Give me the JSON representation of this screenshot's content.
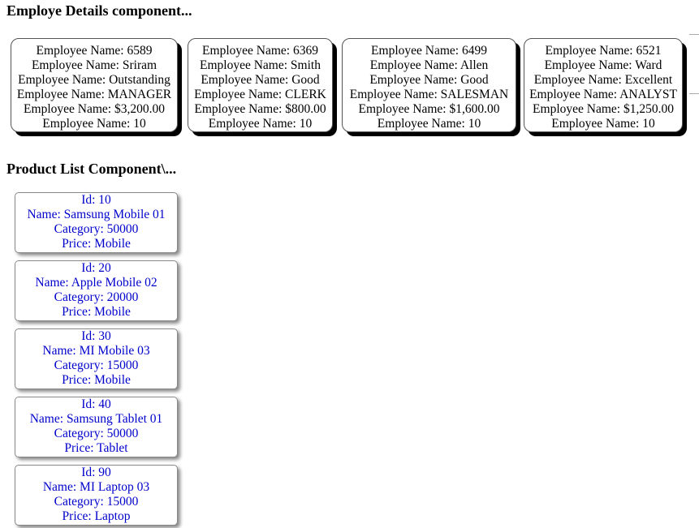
{
  "employee_section": {
    "heading": "Employe Details component...",
    "label": "Employee Name: ",
    "employees": [
      {
        "id": "6589",
        "name": "Sriram",
        "rating": "Outstanding",
        "job": "MANAGER",
        "salary": "$3,200.00",
        "dept": "10"
      },
      {
        "id": "6369",
        "name": "Smith",
        "rating": "Good",
        "job": "CLERK",
        "salary": "$800.00",
        "dept": "10"
      },
      {
        "id": "6499",
        "name": "Allen",
        "rating": "Good",
        "job": "SALESMAN",
        "salary": "$1,600.00",
        "dept": "10"
      },
      {
        "id": "6521",
        "name": "Ward",
        "rating": "Excellent",
        "job": "ANALYST",
        "salary": "$1,250.00",
        "dept": "10"
      }
    ]
  },
  "product_section": {
    "heading": "Product List Component\\...",
    "labels": {
      "id": "Id: ",
      "name": "Name: ",
      "category": "Category: ",
      "price": "Price: "
    },
    "products": [
      {
        "id": "10",
        "name": "Samsung Mobile 01",
        "category": "50000",
        "price": "Mobile"
      },
      {
        "id": "20",
        "name": "Apple Mobile 02",
        "category": "20000",
        "price": "Mobile"
      },
      {
        "id": "30",
        "name": "MI Mobile 03",
        "category": "15000",
        "price": "Mobile"
      },
      {
        "id": "40",
        "name": "Samsung Tablet 01",
        "category": "50000",
        "price": "Tablet"
      },
      {
        "id": "90",
        "name": "MI Laptop 03",
        "category": "15000",
        "price": "Laptop"
      }
    ]
  }
}
